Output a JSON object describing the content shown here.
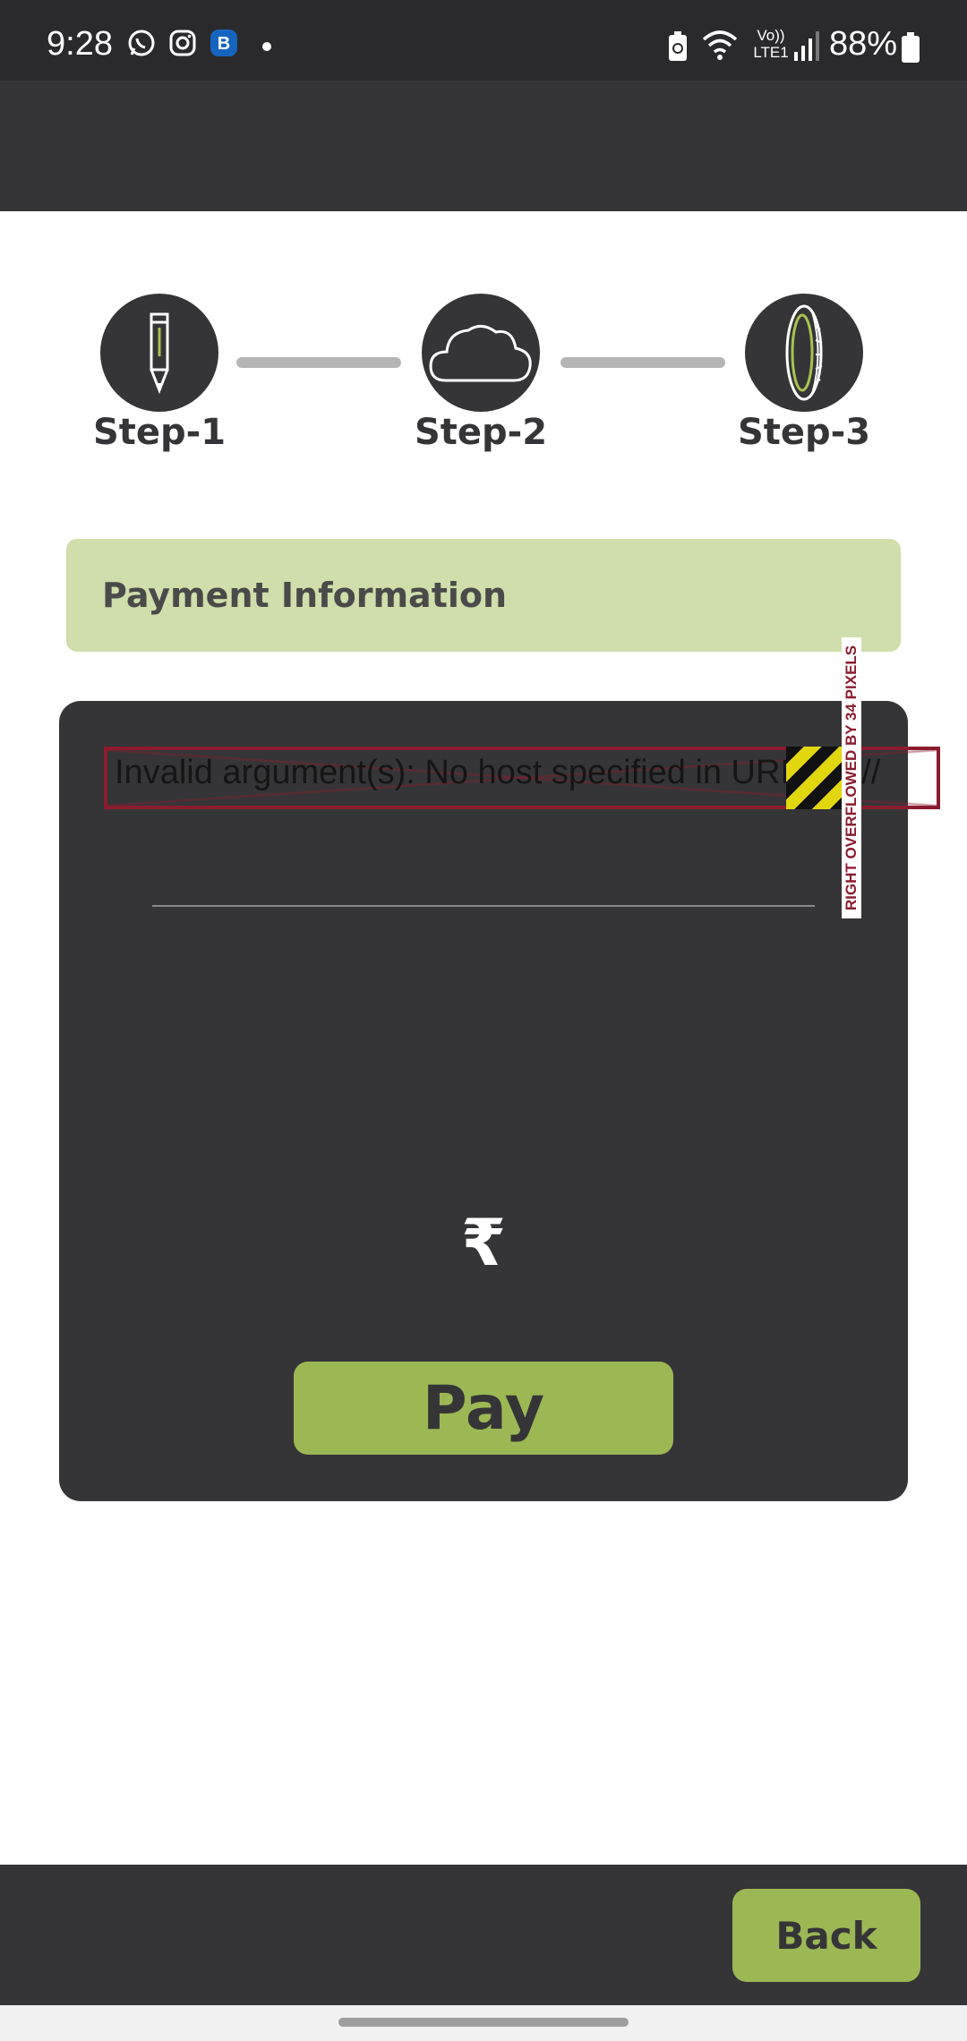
{
  "status_bar": {
    "time": "9:28",
    "battery": "88%",
    "network": "Vo)) LTE1",
    "icons": [
      "whatsapp-icon",
      "instagram-icon",
      "app-icon",
      "dot-icon",
      "battery-saver-icon",
      "wifi-icon",
      "volte-icon",
      "signal-icon",
      "battery-icon"
    ]
  },
  "stepper": {
    "steps": [
      {
        "label": "Step-1",
        "icon": "pencil-icon"
      },
      {
        "label": "Step-2",
        "icon": "cloud-icon"
      },
      {
        "label": "Step-3",
        "icon": "coin-icon"
      }
    ]
  },
  "banner": {
    "title": "Payment Information"
  },
  "card": {
    "error_text": "Invalid argument(s): No host specified in URI file:///",
    "overflow_label": "RIGHT OVERFLOWED BY 34 PIXELS",
    "currency_symbol": "₹",
    "pay_label": "Pay"
  },
  "footer": {
    "back_label": "Back"
  },
  "colors": {
    "dark": "#353537",
    "accent_green": "#9cb854",
    "banner_green": "#cfdeaa",
    "step_line": "#b5b5b5",
    "error_red": "#8b1c2e"
  }
}
